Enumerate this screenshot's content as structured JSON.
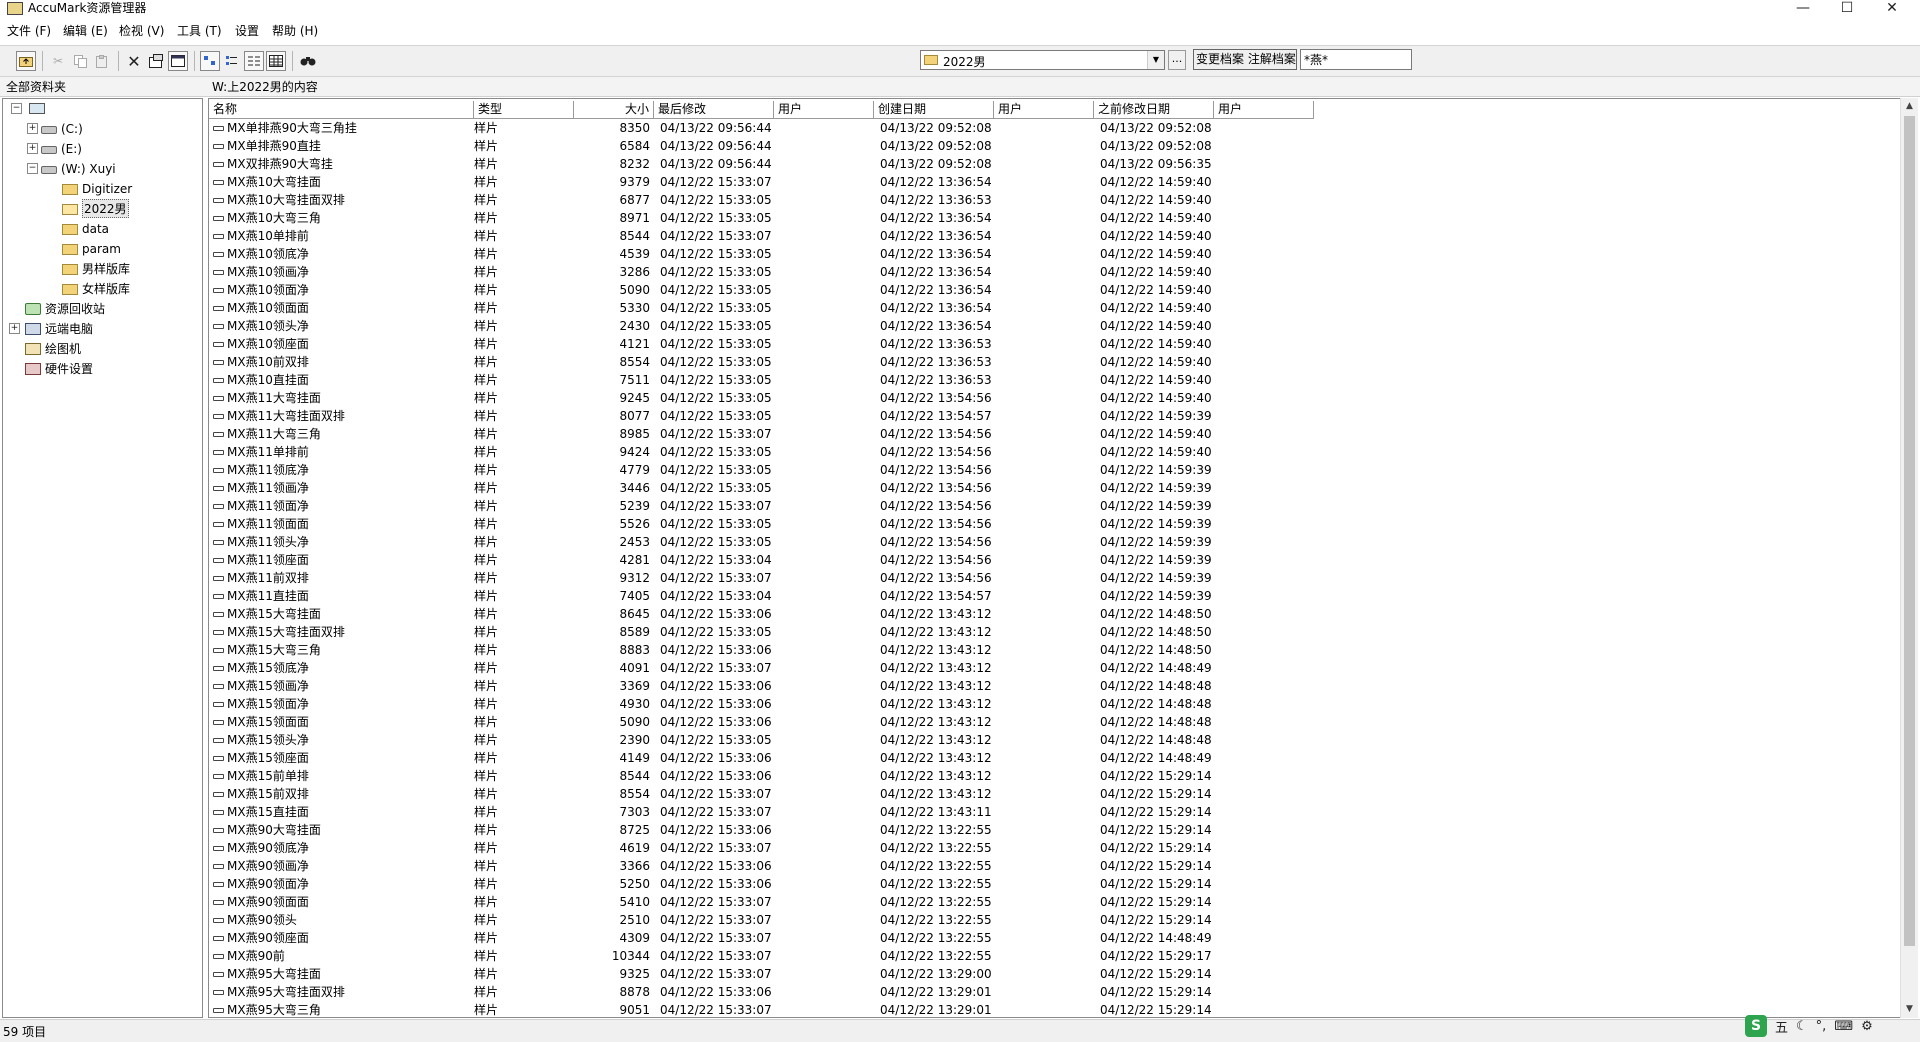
{
  "window": {
    "title": "AccuMark资源管理器",
    "minimize": "—",
    "maximize": "☐",
    "close": "✕"
  },
  "menu": [
    "文件 (F)",
    "编辑 (E)",
    "检视 (V)",
    "工具 (T)",
    "设置",
    "帮助 (H)"
  ],
  "toolbar": {
    "icons": [
      "up-folder-icon",
      "cut-icon",
      "copy-icon",
      "paste-icon",
      "delete-icon",
      "properties-icon",
      "new-window-icon",
      "large-icons-icon",
      "small-icons-icon",
      "list-view-icon",
      "details-view-icon",
      "find-icon"
    ],
    "path_value": "2022男",
    "browse_label": "...",
    "filter_button_label": "变更档案 注解档案",
    "filter_value": "*燕*"
  },
  "left_header": "全部资料夹",
  "right_header": "W:上2022男的内容",
  "tree": [
    {
      "label": "",
      "icon": "computer-icon",
      "expander": "−",
      "level": 0
    },
    {
      "label": "(C:)",
      "icon": "drive-icon",
      "expander": "+",
      "level": 1
    },
    {
      "label": "(E:)",
      "icon": "drive-icon",
      "expander": "+",
      "level": 1
    },
    {
      "label": "(W:) Xuyi",
      "icon": "network-drive-icon",
      "expander": "−",
      "level": 1
    },
    {
      "label": "Digitizer",
      "icon": "folder-icon",
      "expander": "",
      "level": 2
    },
    {
      "label": "2022男",
      "icon": "open-folder-icon",
      "expander": "",
      "level": 2,
      "selected": true
    },
    {
      "label": "data",
      "icon": "folder-icon",
      "expander": "",
      "level": 2
    },
    {
      "label": "param",
      "icon": "folder-icon",
      "expander": "",
      "level": 2
    },
    {
      "label": "男样版库",
      "icon": "folder-icon",
      "expander": "",
      "level": 2
    },
    {
      "label": "女样版库",
      "icon": "folder-icon",
      "expander": "",
      "level": 2
    },
    {
      "label": "资源回收站",
      "icon": "recycle-bin-icon",
      "expander": "",
      "level": 1
    },
    {
      "label": "远端电脑",
      "icon": "network-icon",
      "expander": "+",
      "level": 1
    },
    {
      "label": "绘图机",
      "icon": "plotter-icon",
      "expander": "",
      "level": 1
    },
    {
      "label": "硬件设置",
      "icon": "hardware-icon",
      "expander": "",
      "level": 1
    }
  ],
  "columns": [
    "名称",
    "类型",
    "大小",
    "最后修改",
    "用户",
    "创建日期",
    "用户",
    "之前修改日期",
    "用户"
  ],
  "rows": [
    [
      "MX单排燕90大弯三角挂",
      "样片",
      "8350",
      "04/13/22 09:56:44",
      "",
      "04/13/22 09:52:08",
      "",
      "04/13/22 09:52:08",
      ""
    ],
    [
      "MX单排燕90直挂",
      "样片",
      "6584",
      "04/13/22 09:56:44",
      "",
      "04/13/22 09:52:08",
      "",
      "04/13/22 09:52:08",
      ""
    ],
    [
      "MX双排燕90大弯挂",
      "样片",
      "8232",
      "04/13/22 09:56:44",
      "",
      "04/13/22 09:52:08",
      "",
      "04/13/22 09:56:35",
      ""
    ],
    [
      "MX燕10大弯挂面",
      "样片",
      "9379",
      "04/12/22 15:33:07",
      "",
      "04/12/22 13:36:54",
      "",
      "04/12/22 14:59:40",
      ""
    ],
    [
      "MX燕10大弯挂面双排",
      "样片",
      "6877",
      "04/12/22 15:33:05",
      "",
      "04/12/22 13:36:53",
      "",
      "04/12/22 14:59:40",
      ""
    ],
    [
      "MX燕10大弯三角",
      "样片",
      "8971",
      "04/12/22 15:33:05",
      "",
      "04/12/22 13:36:54",
      "",
      "04/12/22 14:59:40",
      ""
    ],
    [
      "MX燕10单排前",
      "样片",
      "8544",
      "04/12/22 15:33:07",
      "",
      "04/12/22 13:36:54",
      "",
      "04/12/22 14:59:40",
      ""
    ],
    [
      "MX燕10领底净",
      "样片",
      "4539",
      "04/12/22 15:33:05",
      "",
      "04/12/22 13:36:54",
      "",
      "04/12/22 14:59:40",
      ""
    ],
    [
      "MX燕10领画净",
      "样片",
      "3286",
      "04/12/22 15:33:05",
      "",
      "04/12/22 13:36:54",
      "",
      "04/12/22 14:59:40",
      ""
    ],
    [
      "MX燕10领面净",
      "样片",
      "5090",
      "04/12/22 15:33:05",
      "",
      "04/12/22 13:36:54",
      "",
      "04/12/22 14:59:40",
      ""
    ],
    [
      "MX燕10领面面",
      "样片",
      "5330",
      "04/12/22 15:33:05",
      "",
      "04/12/22 13:36:54",
      "",
      "04/12/22 14:59:40",
      ""
    ],
    [
      "MX燕10领头净",
      "样片",
      "2430",
      "04/12/22 15:33:05",
      "",
      "04/12/22 13:36:54",
      "",
      "04/12/22 14:59:40",
      ""
    ],
    [
      "MX燕10领座面",
      "样片",
      "4121",
      "04/12/22 15:33:05",
      "",
      "04/12/22 13:36:53",
      "",
      "04/12/22 14:59:40",
      ""
    ],
    [
      "MX燕10前双排",
      "样片",
      "8554",
      "04/12/22 15:33:05",
      "",
      "04/12/22 13:36:53",
      "",
      "04/12/22 14:59:40",
      ""
    ],
    [
      "MX燕10直挂面",
      "样片",
      "7511",
      "04/12/22 15:33:05",
      "",
      "04/12/22 13:36:53",
      "",
      "04/12/22 14:59:40",
      ""
    ],
    [
      "MX燕11大弯挂面",
      "样片",
      "9245",
      "04/12/22 15:33:05",
      "",
      "04/12/22 13:54:56",
      "",
      "04/12/22 14:59:40",
      ""
    ],
    [
      "MX燕11大弯挂面双排",
      "样片",
      "8077",
      "04/12/22 15:33:05",
      "",
      "04/12/22 13:54:57",
      "",
      "04/12/22 14:59:39",
      ""
    ],
    [
      "MX燕11大弯三角",
      "样片",
      "8985",
      "04/12/22 15:33:07",
      "",
      "04/12/22 13:54:56",
      "",
      "04/12/22 14:59:40",
      ""
    ],
    [
      "MX燕11单排前",
      "样片",
      "9424",
      "04/12/22 15:33:05",
      "",
      "04/12/22 13:54:56",
      "",
      "04/12/22 14:59:40",
      ""
    ],
    [
      "MX燕11领底净",
      "样片",
      "4779",
      "04/12/22 15:33:05",
      "",
      "04/12/22 13:54:56",
      "",
      "04/12/22 14:59:39",
      ""
    ],
    [
      "MX燕11领画净",
      "样片",
      "3446",
      "04/12/22 15:33:05",
      "",
      "04/12/22 13:54:56",
      "",
      "04/12/22 14:59:39",
      ""
    ],
    [
      "MX燕11领面净",
      "样片",
      "5239",
      "04/12/22 15:33:07",
      "",
      "04/12/22 13:54:56",
      "",
      "04/12/22 14:59:39",
      ""
    ],
    [
      "MX燕11领面面",
      "样片",
      "5526",
      "04/12/22 15:33:05",
      "",
      "04/12/22 13:54:56",
      "",
      "04/12/22 14:59:39",
      ""
    ],
    [
      "MX燕11领头净",
      "样片",
      "2453",
      "04/12/22 15:33:05",
      "",
      "04/12/22 13:54:56",
      "",
      "04/12/22 14:59:39",
      ""
    ],
    [
      "MX燕11领座面",
      "样片",
      "4281",
      "04/12/22 15:33:04",
      "",
      "04/12/22 13:54:56",
      "",
      "04/12/22 14:59:39",
      ""
    ],
    [
      "MX燕11前双排",
      "样片",
      "9312",
      "04/12/22 15:33:07",
      "",
      "04/12/22 13:54:56",
      "",
      "04/12/22 14:59:39",
      ""
    ],
    [
      "MX燕11直挂面",
      "样片",
      "7405",
      "04/12/22 15:33:04",
      "",
      "04/12/22 13:54:57",
      "",
      "04/12/22 14:59:39",
      ""
    ],
    [
      "MX燕15大弯挂面",
      "样片",
      "8645",
      "04/12/22 15:33:06",
      "",
      "04/12/22 13:43:12",
      "",
      "04/12/22 14:48:50",
      ""
    ],
    [
      "MX燕15大弯挂面双排",
      "样片",
      "8589",
      "04/12/22 15:33:05",
      "",
      "04/12/22 13:43:12",
      "",
      "04/12/22 14:48:50",
      ""
    ],
    [
      "MX燕15大弯三角",
      "样片",
      "8883",
      "04/12/22 15:33:06",
      "",
      "04/12/22 13:43:12",
      "",
      "04/12/22 14:48:50",
      ""
    ],
    [
      "MX燕15领底净",
      "样片",
      "4091",
      "04/12/22 15:33:07",
      "",
      "04/12/22 13:43:12",
      "",
      "04/12/22 14:48:49",
      ""
    ],
    [
      "MX燕15领画净",
      "样片",
      "3369",
      "04/12/22 15:33:06",
      "",
      "04/12/22 13:43:12",
      "",
      "04/12/22 14:48:48",
      ""
    ],
    [
      "MX燕15领面净",
      "样片",
      "4930",
      "04/12/22 15:33:06",
      "",
      "04/12/22 13:43:12",
      "",
      "04/12/22 14:48:48",
      ""
    ],
    [
      "MX燕15领面面",
      "样片",
      "5090",
      "04/12/22 15:33:06",
      "",
      "04/12/22 13:43:12",
      "",
      "04/12/22 14:48:48",
      ""
    ],
    [
      "MX燕15领头净",
      "样片",
      "2390",
      "04/12/22 15:33:05",
      "",
      "04/12/22 13:43:12",
      "",
      "04/12/22 14:48:48",
      ""
    ],
    [
      "MX燕15领座面",
      "样片",
      "4149",
      "04/12/22 15:33:06",
      "",
      "04/12/22 13:43:12",
      "",
      "04/12/22 14:48:49",
      ""
    ],
    [
      "MX燕15前单排",
      "样片",
      "8544",
      "04/12/22 15:33:06",
      "",
      "04/12/22 13:43:12",
      "",
      "04/12/22 15:29:14",
      ""
    ],
    [
      "MX燕15前双排",
      "样片",
      "8554",
      "04/12/22 15:33:07",
      "",
      "04/12/22 13:43:12",
      "",
      "04/12/22 15:29:14",
      ""
    ],
    [
      "MX燕15直挂面",
      "样片",
      "7303",
      "04/12/22 15:33:07",
      "",
      "04/12/22 13:43:11",
      "",
      "04/12/22 15:29:14",
      ""
    ],
    [
      "MX燕90大弯挂面",
      "样片",
      "8725",
      "04/12/22 15:33:06",
      "",
      "04/12/22 13:22:55",
      "",
      "04/12/22 15:29:14",
      ""
    ],
    [
      "MX燕90领底净",
      "样片",
      "4619",
      "04/12/22 15:33:07",
      "",
      "04/12/22 13:22:55",
      "",
      "04/12/22 15:29:14",
      ""
    ],
    [
      "MX燕90领画净",
      "样片",
      "3366",
      "04/12/22 15:33:06",
      "",
      "04/12/22 13:22:55",
      "",
      "04/12/22 15:29:14",
      ""
    ],
    [
      "MX燕90领面净",
      "样片",
      "5250",
      "04/12/22 15:33:06",
      "",
      "04/12/22 13:22:55",
      "",
      "04/12/22 15:29:14",
      ""
    ],
    [
      "MX燕90领面面",
      "样片",
      "5410",
      "04/12/22 15:33:07",
      "",
      "04/12/22 13:22:55",
      "",
      "04/12/22 15:29:14",
      ""
    ],
    [
      "MX燕90领头",
      "样片",
      "2510",
      "04/12/22 15:33:07",
      "",
      "04/12/22 13:22:55",
      "",
      "04/12/22 15:29:14",
      ""
    ],
    [
      "MX燕90领座面",
      "样片",
      "4309",
      "04/12/22 15:33:07",
      "",
      "04/12/22 13:22:55",
      "",
      "04/12/22 14:48:49",
      ""
    ],
    [
      "MX燕90前",
      "样片",
      "10344",
      "04/12/22 15:33:07",
      "",
      "04/12/22 13:22:55",
      "",
      "04/12/22 15:29:17",
      ""
    ],
    [
      "MX燕95大弯挂面",
      "样片",
      "9325",
      "04/12/22 15:33:07",
      "",
      "04/12/22 13:29:00",
      "",
      "04/12/22 15:29:14",
      ""
    ],
    [
      "MX燕95大弯挂面双排",
      "样片",
      "8878",
      "04/12/22 15:33:06",
      "",
      "04/12/22 13:29:01",
      "",
      "04/12/22 15:29:14",
      ""
    ],
    [
      "MX燕95大弯三角",
      "样片",
      "9051",
      "04/12/22 15:33:07",
      "",
      "04/12/22 13:29:01",
      "",
      "04/12/22 15:29:14",
      ""
    ]
  ],
  "status": "59 项目",
  "ime": [
    "五",
    "☾",
    "°,",
    "⌨",
    "⚙"
  ]
}
